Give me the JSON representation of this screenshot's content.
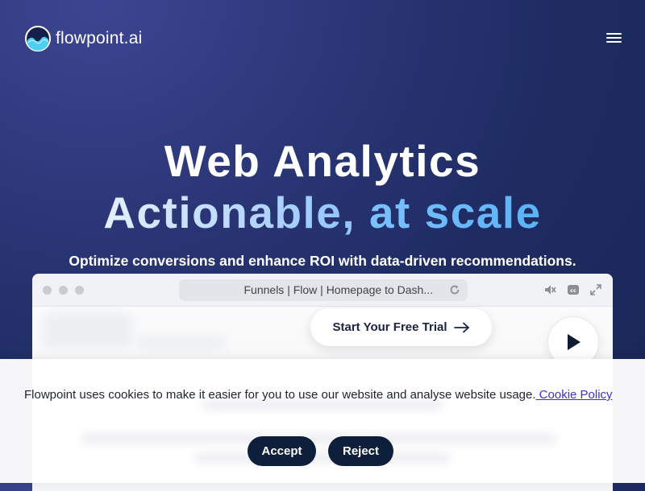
{
  "brand": {
    "name": "flowpoint.ai",
    "logo_icon": "flowpoint-wave-logo"
  },
  "nav": {
    "menu_icon": "hamburger-menu-icon"
  },
  "hero": {
    "title": "Web Analytics",
    "subtitle_part1": "Actionable,",
    "subtitle_part2": "at scale",
    "tagline": "Optimize conversions and enhance ROI with data-driven recommendations."
  },
  "browser": {
    "url": "Funnels | Flow | Homepage to Dash...",
    "icons": [
      "reload-icon",
      "mute-icon",
      "captions-icon",
      "fullscreen-icon"
    ]
  },
  "cta": {
    "trial_label": "Start Your Free Trial",
    "arrow_icon": "arrow-right-icon",
    "play_icon": "play-icon"
  },
  "cookie_banner": {
    "message": "Flowpoint uses cookies to make it easier for you to use our website and analyse website usage.",
    "link_label": " Cookie Policy",
    "accept_label": "Accept",
    "reject_label": "Reject"
  },
  "colors": {
    "hero_bg": "#1e2c62",
    "accent_light": "#b9d8ff",
    "accent_blue": "#5ab2f5",
    "button_dark": "#0e1f3c",
    "link": "#3a2fd6"
  }
}
